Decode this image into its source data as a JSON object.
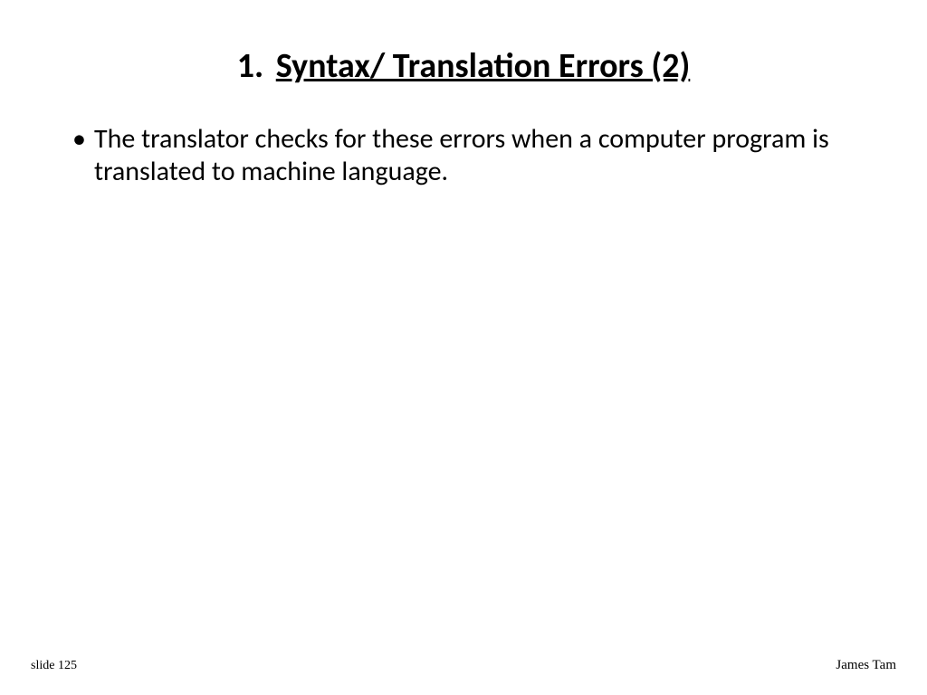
{
  "title": {
    "number": "1.",
    "text": "Syntax/ Translation Errors (2)"
  },
  "bullets": [
    "The translator checks for these errors when a computer program is translated to machine language."
  ],
  "footer": {
    "left": "slide 125",
    "right": "James Tam"
  }
}
